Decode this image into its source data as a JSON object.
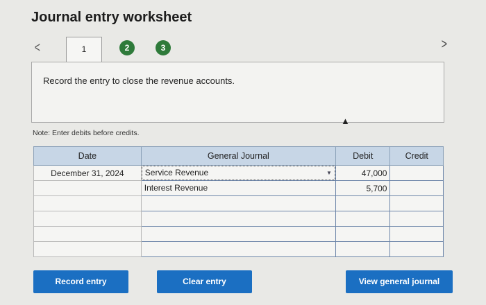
{
  "header": {
    "title": "Journal entry worksheet"
  },
  "steps": {
    "prev": "<",
    "next": ">",
    "items": [
      "1",
      "2",
      "3"
    ]
  },
  "instruction": "Record the entry to close the revenue accounts.",
  "note": "Note: Enter debits before credits.",
  "table": {
    "headers": {
      "date": "Date",
      "journal": "General Journal",
      "debit": "Debit",
      "credit": "Credit"
    },
    "rows": [
      {
        "date": "December 31, 2024",
        "account": "Service Revenue",
        "debit": "47,000",
        "credit": ""
      },
      {
        "date": "",
        "account": "Interest Revenue",
        "debit": "5,700",
        "credit": ""
      },
      {
        "date": "",
        "account": "",
        "debit": "",
        "credit": ""
      },
      {
        "date": "",
        "account": "",
        "debit": "",
        "credit": ""
      },
      {
        "date": "",
        "account": "",
        "debit": "",
        "credit": ""
      },
      {
        "date": "",
        "account": "",
        "debit": "",
        "credit": ""
      }
    ]
  },
  "buttons": {
    "record": "Record entry",
    "clear": "Clear entry",
    "view": "View general journal"
  },
  "colors": {
    "accent": "#1b6fc2",
    "step_done": "#2e7a3a",
    "header_bg": "#c7d6e6"
  }
}
